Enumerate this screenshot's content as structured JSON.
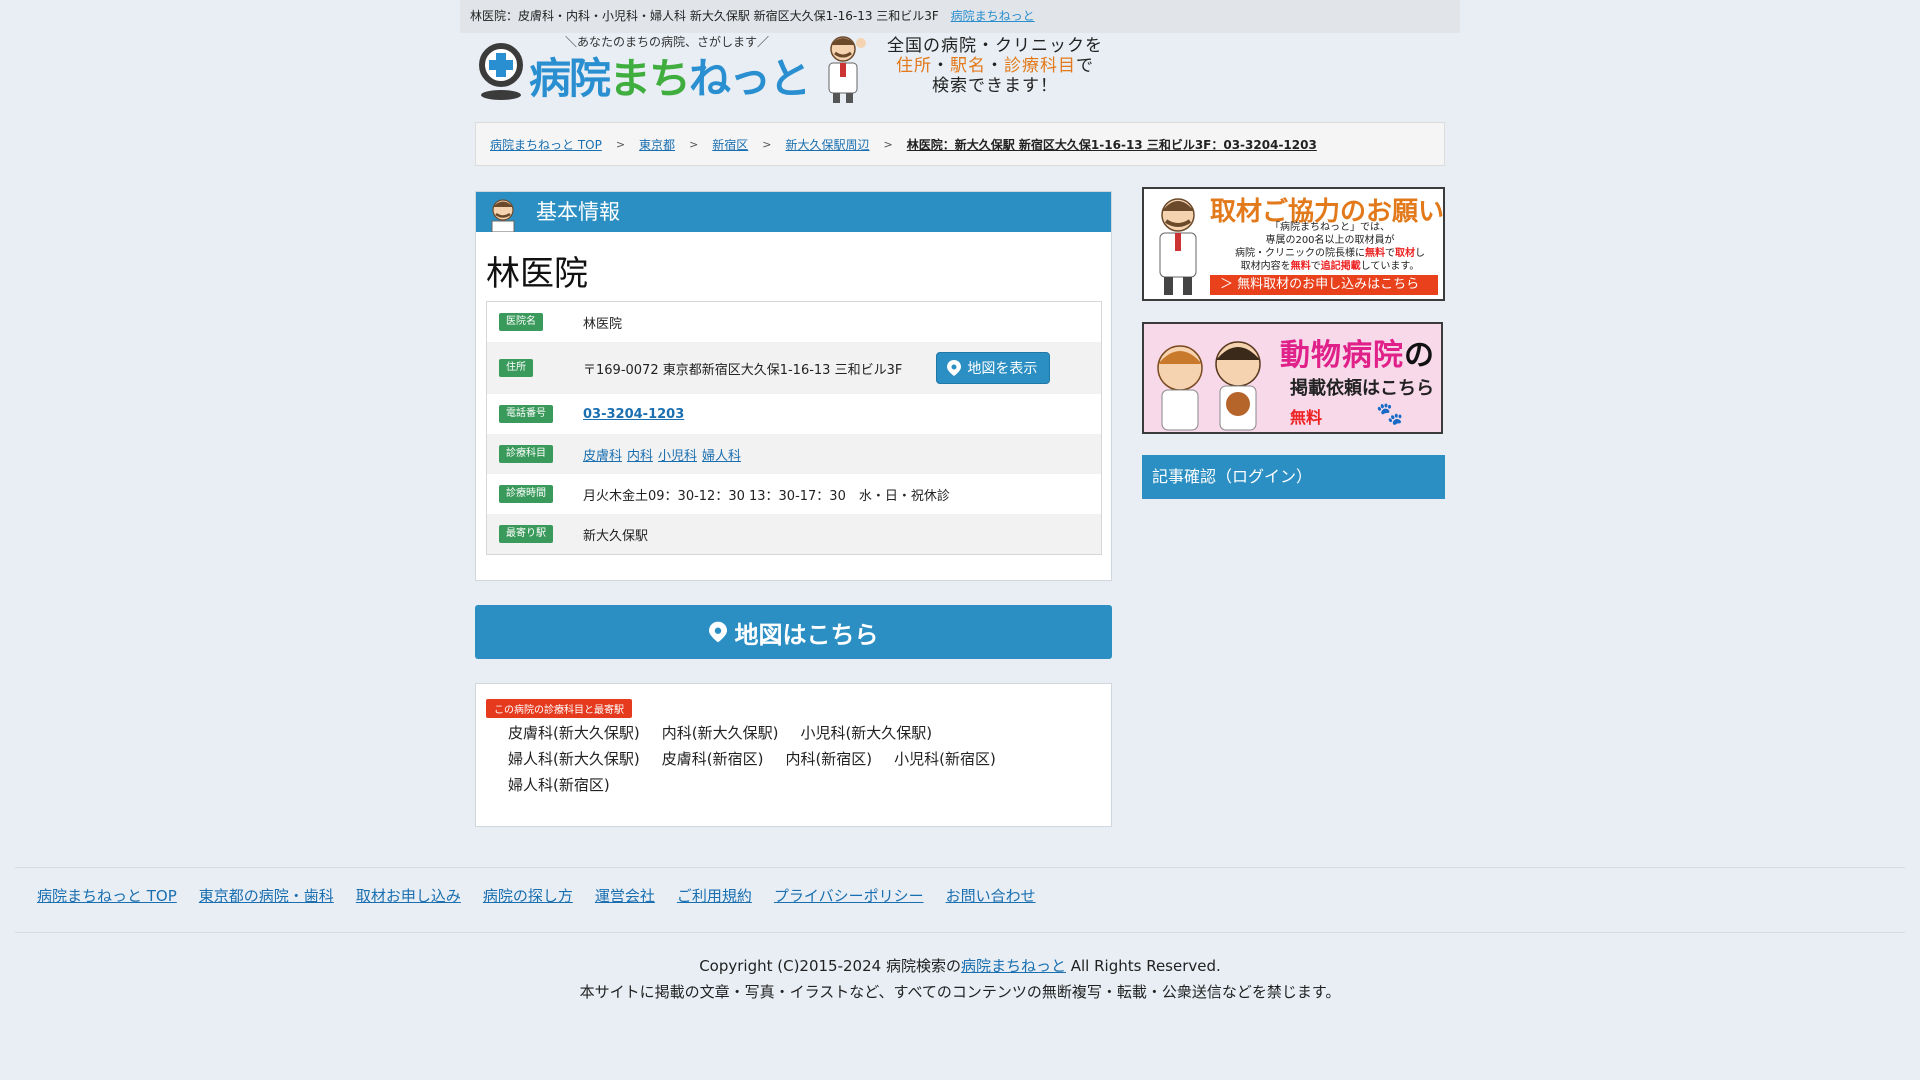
{
  "topbar": {
    "text": "林医院：皮膚科・内科・小児科・婦人科 新大久保駅 新宿区大久保1-16-13 三和ビル3F",
    "link": "病院まちねっと"
  },
  "header": {
    "logo_tagline": "＼あなたのまちの病院、さがします／",
    "logo_text_a": "病院",
    "logo_text_b": "まち",
    "logo_text_c": "ねっと",
    "msg_line1": "全国の病院・クリニックを",
    "msg_hl1": "住所",
    "msg_dot1": "・",
    "msg_hl2": "駅名",
    "msg_dot2": "・",
    "msg_hl3": "診療科目",
    "msg_de": "で",
    "msg_line3": "検索できます！"
  },
  "breadcrumb": {
    "items": [
      "病院まちねっと TOP",
      "東京都",
      "新宿区",
      "新大久保駅周辺"
    ],
    "separator": ">",
    "current": "林医院：新大久保駅 新宿区大久保1-16-13 三和ビル3F：03-3204-1203"
  },
  "basic_info": {
    "heading": "基本情報",
    "clinic_name": "林医院",
    "rows": {
      "name": {
        "label": "医院名",
        "value": "林医院"
      },
      "address": {
        "label": "住所",
        "value": "〒169-0072 東京都新宿区大久保1-16-13 三和ビル3F",
        "map_button": "地図を表示"
      },
      "tel": {
        "label": "電話番号",
        "value": "03-3204-1203"
      },
      "dept": {
        "label": "診療科目",
        "items": [
          "皮膚科",
          "内科",
          "小児科",
          "婦人科"
        ]
      },
      "hours": {
        "label": "診療時間",
        "value": "月火木金土09：30-12：30 13：30-17：30　水・日・祝休診"
      },
      "station": {
        "label": "最寄り駅",
        "value": "新大久保駅"
      }
    }
  },
  "map_big_button": "地図はこちら",
  "related": {
    "badge": "この病院の診療科目と最寄駅",
    "items": [
      "皮膚科(新大久保駅)",
      "内科(新大久保駅)",
      "小児科(新大久保駅)",
      "婦人科(新大久保駅)",
      "皮膚科(新宿区)",
      "内科(新宿区)",
      "小児科(新宿区)",
      "婦人科(新宿区)"
    ]
  },
  "sidebar": {
    "ad1": {
      "title": "取材ご協力のお願い",
      "line1": "「病院まちねっと」では、",
      "line2": "専属の200名以上の取材員が",
      "line3a": "病院・クリニックの院長様に",
      "line3b": "無料",
      "line3c": "で",
      "line3d": "取材",
      "line3e": "し",
      "line4a": "取材内容を",
      "line4b": "無料",
      "line4c": "で",
      "line4d": "追記掲載",
      "line4e": "しています。",
      "cta": "＞ 無料取材のお申し込みはこちら"
    },
    "ad2": {
      "title_a": "動物病院",
      "title_b": "の",
      "line2": "掲載依頼はこちら",
      "line3": "無料"
    },
    "login": "記事確認（ログイン）"
  },
  "footer": {
    "nav": [
      "病院まちねっと TOP",
      "東京都の病院・歯科",
      "取材お申し込み",
      "病院の探し方",
      "運営会社",
      "ご利用規約",
      "プライバシーポリシー",
      "お問い合わせ"
    ],
    "copy_a": "Copyright (C)2015-2024 病院検索の",
    "copy_link": "病院まちねっと",
    "copy_b": " All Rights Reserved.",
    "notice": "本サイトに掲載の文章・写真・イラストなど、すべてのコンテンツの無断複写・転載・公衆送信などを禁じます。"
  },
  "colors": {
    "accent_blue": "#2b8fc3",
    "label_green": "#3a9a5b",
    "badge_red": "#e63a1e",
    "link": "#1a6fb0",
    "background": "#e8eef4"
  },
  "icons": {
    "logo": "magnifier-cross-icon",
    "doctor": "doctor-mascot-icon",
    "pin": "map-pin-icon",
    "paw": "paw-icon"
  }
}
